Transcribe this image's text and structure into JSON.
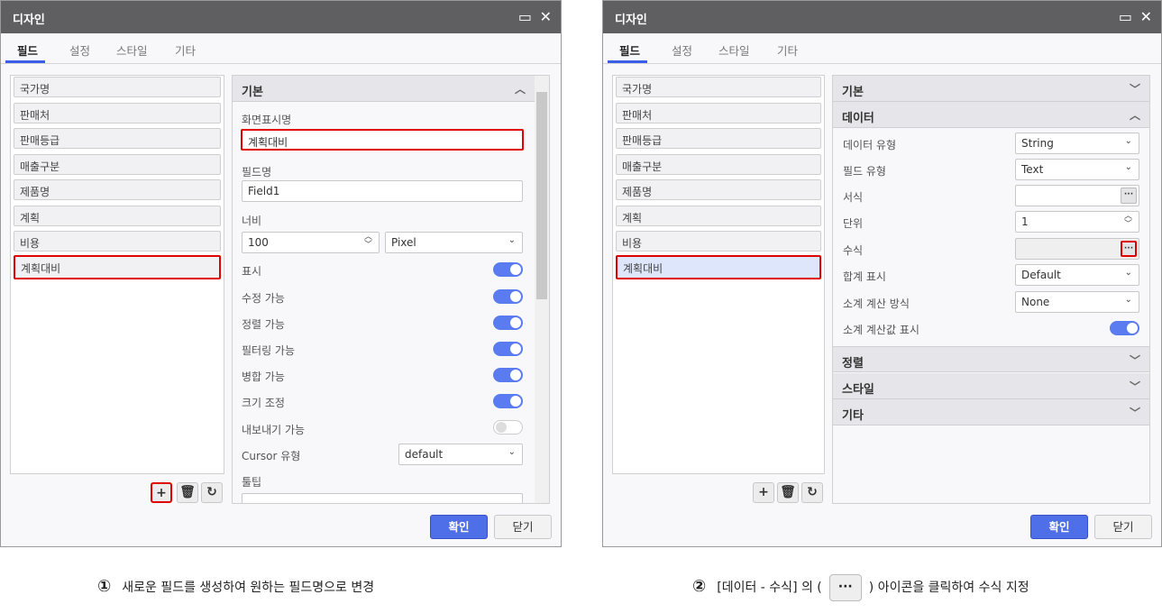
{
  "dialog_title": "디자인",
  "tabs": [
    "필드",
    "설정",
    "스타일",
    "기타"
  ],
  "fields": [
    "국가명",
    "판매처",
    "판매등급",
    "매출구분",
    "제품명",
    "계획",
    "비용",
    "계획대비"
  ],
  "icons": {
    "maximize": "window-maximize-icon",
    "close": "close-icon",
    "add": "plus-icon",
    "delete": "trash-icon",
    "refresh": "refresh-icon",
    "more": "ellipsis-icon"
  },
  "panel1": {
    "section": "기본",
    "display_name_label": "화면표시명",
    "display_name_value": "계획대비",
    "field_name_label": "필드명",
    "field_name_value": "Field1",
    "width_label": "너비",
    "width_value": "100",
    "width_unit": "Pixel",
    "toggles": [
      {
        "label": "표시",
        "on": true
      },
      {
        "label": "수정 가능",
        "on": true
      },
      {
        "label": "정렬 가능",
        "on": true
      },
      {
        "label": "필터링 가능",
        "on": true
      },
      {
        "label": "병합 가능",
        "on": true
      },
      {
        "label": "크기 조정",
        "on": true
      },
      {
        "label": "내보내기 가능",
        "on": false
      }
    ],
    "cursor_label": "Cursor 유형",
    "cursor_value": "default",
    "tooltip_label": "툴팁"
  },
  "panel2": {
    "sections": {
      "basic": "기본",
      "data": "데이터",
      "align": "정렬",
      "style": "스타일",
      "etc": "기타"
    },
    "data_type_label": "데이터 유형",
    "data_type_value": "String",
    "field_type_label": "필드 유형",
    "field_type_value": "Text",
    "format_label": "서식",
    "unit_label": "단위",
    "unit_value": "1",
    "formula_label": "수식",
    "total_label": "합계 표시",
    "total_value": "Default",
    "subtotal_label": "소계 계산 방식",
    "subtotal_value": "None",
    "subtotal_show_label": "소계 계산값 표시",
    "subtotal_show_on": true
  },
  "buttons": {
    "ok": "확인",
    "close": "닫기"
  },
  "captions": [
    {
      "num": "①",
      "text": "새로운 필드를 생성하여 원하는 필드명으로 변경"
    },
    {
      "num": "②",
      "pre": "[데이터 - 수식] 의 (",
      "icon": "···",
      "post": ") 아이콘을 클릭하여 수식 지정"
    }
  ]
}
